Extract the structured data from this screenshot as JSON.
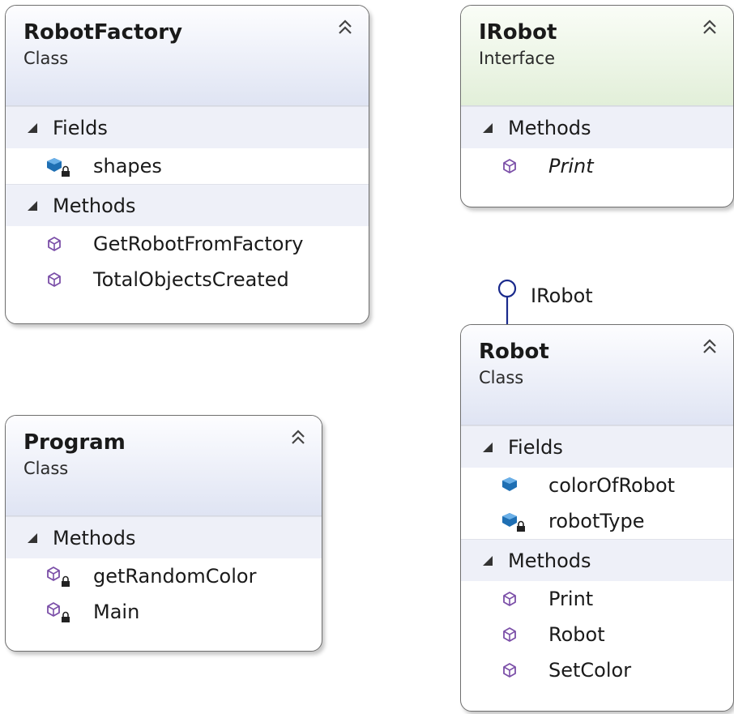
{
  "colors": {
    "border": "#6f6f6f",
    "class_header": "#dfe4f3",
    "interface_header": "#e2efd9",
    "section_band": "#eef0f8",
    "member_icon": "#7b4fa8",
    "field_icon": "#1f6fb3",
    "lollipop": "#1a2a8c"
  },
  "shapes": {
    "robotfactory": {
      "name": "RobotFactory",
      "kind": "Class",
      "fields_label": "Fields",
      "fields": [
        {
          "name": "shapes",
          "icon": "private-field-icon"
        }
      ],
      "methods_label": "Methods",
      "methods": [
        {
          "name": "GetRobotFromFactory",
          "icon": "method-icon"
        },
        {
          "name": "TotalObjectsCreated",
          "icon": "method-icon"
        }
      ]
    },
    "irobot": {
      "name": "IRobot",
      "kind": "Interface",
      "methods_label": "Methods",
      "methods": [
        {
          "name": "Print",
          "icon": "method-icon"
        }
      ]
    },
    "program": {
      "name": "Program",
      "kind": "Class",
      "methods_label": "Methods",
      "methods": [
        {
          "name": "getRandomColor",
          "icon": "private-method-icon"
        },
        {
          "name": "Main",
          "icon": "private-method-icon"
        }
      ]
    },
    "robot": {
      "name": "Robot",
      "kind": "Class",
      "fields_label": "Fields",
      "fields": [
        {
          "name": "colorOfRobot",
          "icon": "field-icon"
        },
        {
          "name": "robotType",
          "icon": "private-field-icon"
        }
      ],
      "methods_label": "Methods",
      "methods": [
        {
          "name": "Print",
          "icon": "method-icon"
        },
        {
          "name": "Robot",
          "icon": "method-icon"
        },
        {
          "name": "SetColor",
          "icon": "method-icon"
        }
      ]
    }
  },
  "implements_label": "IRobot"
}
